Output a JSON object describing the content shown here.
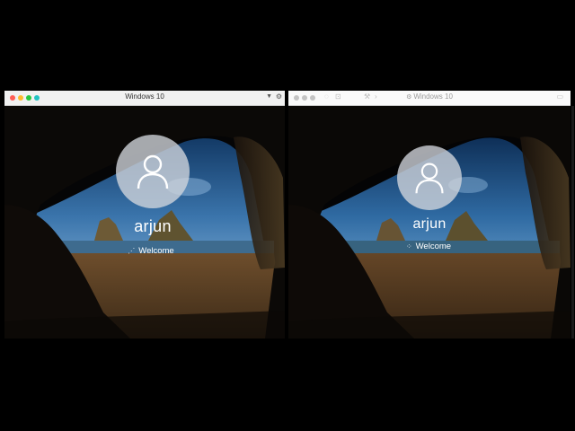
{
  "left_window": {
    "title": "Windows 10",
    "traffic_lights": {
      "close": "#ff5f57",
      "minimize": "#febc2e",
      "zoom": "#28c840",
      "extra": "#22c3c3"
    },
    "toolbar_icons": [
      "chevron-down-icon",
      "gear-icon"
    ],
    "login": {
      "username": "arjun",
      "status": "Welcome",
      "spinner": "⋰"
    }
  },
  "right_window": {
    "title": "Windows 10",
    "title_icon": "gear-icon",
    "traffic_lights": {
      "close": "#c4c4c4",
      "minimize": "#c4c4c4",
      "zoom": "#c4c4c4"
    },
    "toolbar_icons": [
      "wrench-icon",
      "back-icon",
      "forward-icon",
      "toolbar-control-icon"
    ],
    "login": {
      "username": "arjun",
      "status": "Welcome",
      "spinner": "⁘"
    }
  }
}
